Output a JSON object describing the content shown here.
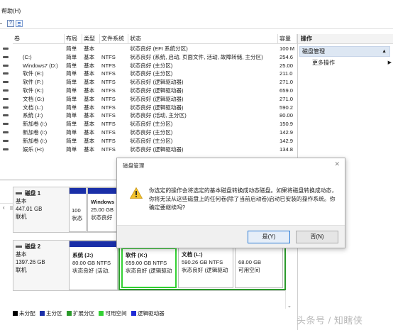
{
  "menubar": {
    "help_label": "帮助(H)"
  },
  "toolbar": {
    "help_button": "?"
  },
  "columns": [
    "卷",
    "布局",
    "类型",
    "文件系统",
    "状态",
    "容量"
  ],
  "volumes": [
    {
      "name": "",
      "layout": "简单",
      "type": "基本",
      "fs": "",
      "status": "状态良好 (EFI 系统分区)",
      "capacity": "100 M"
    },
    {
      "name": "(C:)",
      "layout": "简单",
      "type": "基本",
      "fs": "NTFS",
      "status": "状态良好 (系统, 启动, 页面文件, 活动, 故障转储, 主分区)",
      "capacity": "254.6"
    },
    {
      "name": "Windows7 (D:)",
      "layout": "简单",
      "type": "基本",
      "fs": "NTFS",
      "status": "状态良好 (主分区)",
      "capacity": "25.00"
    },
    {
      "name": "软件 (E:)",
      "layout": "简单",
      "type": "基本",
      "fs": "NTFS",
      "status": "状态良好 (主分区)",
      "capacity": "211.0"
    },
    {
      "name": "软件 (F:)",
      "layout": "简单",
      "type": "基本",
      "fs": "NTFS",
      "status": "状态良好 (逻辑驱动器)",
      "capacity": "271.0"
    },
    {
      "name": "软件 (K:)",
      "layout": "简单",
      "type": "基本",
      "fs": "NTFS",
      "status": "状态良好 (逻辑驱动器)",
      "capacity": "659.0"
    },
    {
      "name": "文档 (G:)",
      "layout": "简单",
      "type": "基本",
      "fs": "NTFS",
      "status": "状态良好 (逻辑驱动器)",
      "capacity": "271.0"
    },
    {
      "name": "文档 (L:)",
      "layout": "简单",
      "type": "基本",
      "fs": "NTFS",
      "status": "状态良好 (逻辑驱动器)",
      "capacity": "590.2"
    },
    {
      "name": "系统 (J:)",
      "layout": "简单",
      "type": "基本",
      "fs": "NTFS",
      "status": "状态良好 (活动, 主分区)",
      "capacity": "80.00"
    },
    {
      "name": "新加卷 (I:)",
      "layout": "简单",
      "type": "基本",
      "fs": "NTFS",
      "status": "状态良好 (主分区)",
      "capacity": "150.9"
    },
    {
      "name": "新加卷 (I:)",
      "layout": "简单",
      "type": "基本",
      "fs": "NTFS",
      "status": "状态良好 (主分区)",
      "capacity": "142.9"
    },
    {
      "name": "新加卷 (I:)",
      "layout": "简单",
      "type": "基本",
      "fs": "NTFS",
      "status": "状态良好 (主分区)",
      "capacity": "142.9"
    },
    {
      "name": "娱乐 (H:)",
      "layout": "简单",
      "type": "基本",
      "fs": "NTFS",
      "status": "状态良好 (逻辑驱动器)",
      "capacity": "134.8"
    }
  ],
  "actions": {
    "title": "操作",
    "section": "磁盘管理",
    "more": "更多操作"
  },
  "disks": [
    {
      "name": "磁盘 1",
      "type": "基本",
      "size": "447.01 GB",
      "status": "联机",
      "partitions": [
        {
          "line1": "100",
          "line2": "状态"
        },
        {
          "name": "Windows",
          "line1": "25.00 GB",
          "line2": "状态良好"
        }
      ]
    },
    {
      "name": "磁盘 2",
      "type": "基本",
      "size": "1397.26 GB",
      "status": "联机",
      "partitions": [
        {
          "name": "系统 (J:)",
          "line1": "80.00 GB NTFS",
          "line2": "状态良好 (活动,"
        },
        {
          "name": "软件 (K:)",
          "line1": "659.00 GB NTFS",
          "line2": "状态良好 (逻辑驱动"
        },
        {
          "name": "文档 (L:)",
          "line1": "590.26 GB NTFS",
          "line2": "状态良好 (逻辑驱动"
        },
        {
          "line1": "68.00 GB",
          "line2": "可用空间"
        }
      ]
    }
  ],
  "legend": [
    "未分配",
    "主分区",
    "扩展分区",
    "可用空间",
    "逻辑驱动器"
  ],
  "legend_colors": [
    "#000000",
    "#1a2fa8",
    "#2b9a2b",
    "#33d133",
    "#1f2bd6"
  ],
  "dialog": {
    "title": "磁盘管理",
    "message": "你选定的操作会将选定的基本磁盘转换成动态磁盘。如果将磁盘转换成动态，你将无法从这些磁盘上的任何卷(除了当前启动卷)启动已安装的操作系统。你确定要继续吗?",
    "yes_label": "是(Y)",
    "no_label": "否(N)"
  },
  "watermark": "头条号 / 知瞎侠"
}
